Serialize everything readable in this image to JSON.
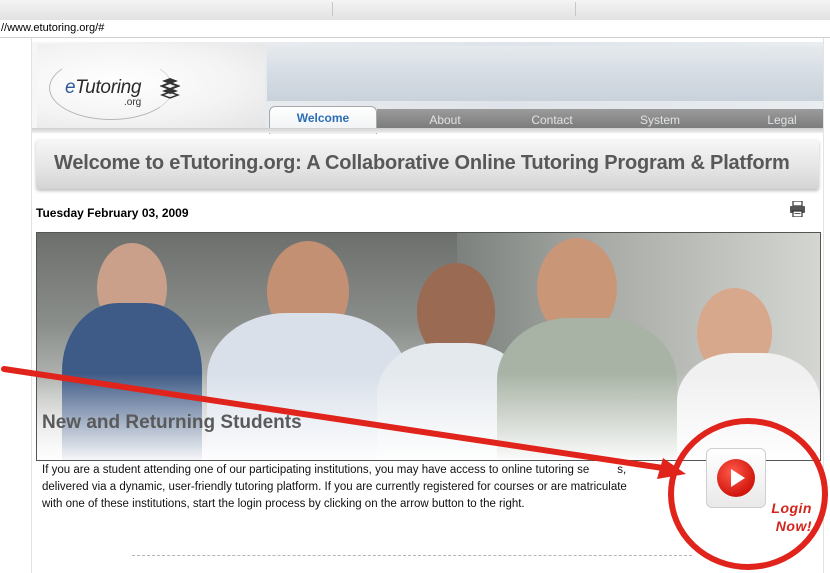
{
  "browser": {
    "url": "//www.etutoring.org/#"
  },
  "logo": {
    "name_prefix": "e",
    "name_rest": "Tutoring",
    "suffix": ".org"
  },
  "nav": {
    "tabs": [
      "Welcome",
      "About",
      "Contact",
      "System",
      "Legal"
    ],
    "active": "Welcome"
  },
  "page_title": "Welcome to eTutoring.org: A Collaborative Online Tutoring Program & Platform",
  "date": "Tuesday February 03, 2009",
  "section": {
    "heading": "New and Returning Students",
    "body": "If you are a student attending one of our participating institutions, you may have access to online tutoring se",
    "body_tail": "s,",
    "body_line2": "delivered via a dynamic, user-friendly tutoring platform. If you are currently registered for courses or are matriculate",
    "body_line3": "with one of these institutions, start the login process by clicking on the arrow button to the right."
  },
  "login": {
    "line1": "Login",
    "line2": "Now!"
  },
  "colors": {
    "accent_blue": "#2a6fb4",
    "annotation_red": "#e0231b",
    "tab_bar": "#8a8a8a"
  },
  "icons": {
    "print": "printer-icon",
    "play": "play-arrow-icon",
    "logo": "books-icon"
  }
}
